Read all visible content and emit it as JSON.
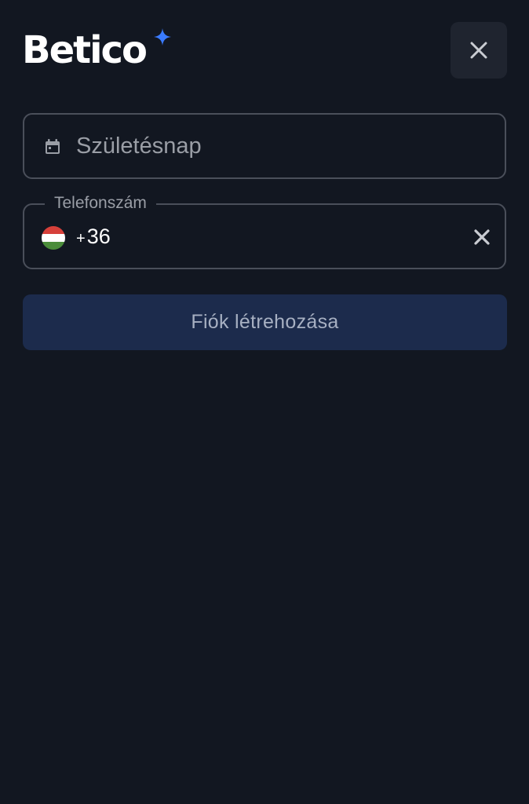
{
  "header": {
    "logo_text": "Betico",
    "close_icon": "close-icon"
  },
  "form": {
    "birthday": {
      "placeholder": "Születésnap",
      "icon": "calendar-icon"
    },
    "phone": {
      "label": "Telefonszám",
      "country_flag": "hungary-flag-icon",
      "prefix_plus": "+",
      "prefix_code": "36",
      "clear_icon": "clear-icon"
    },
    "submit_label": "Fiók létrehozása"
  },
  "colors": {
    "background": "#121721",
    "field_border": "#4a4f5a",
    "close_button_bg": "#1f242f",
    "submit_bg": "#1c2b4c",
    "submit_text": "#a7b0c2",
    "logo_star": "#3a7bff",
    "placeholder_text": "#9a9ea6"
  }
}
